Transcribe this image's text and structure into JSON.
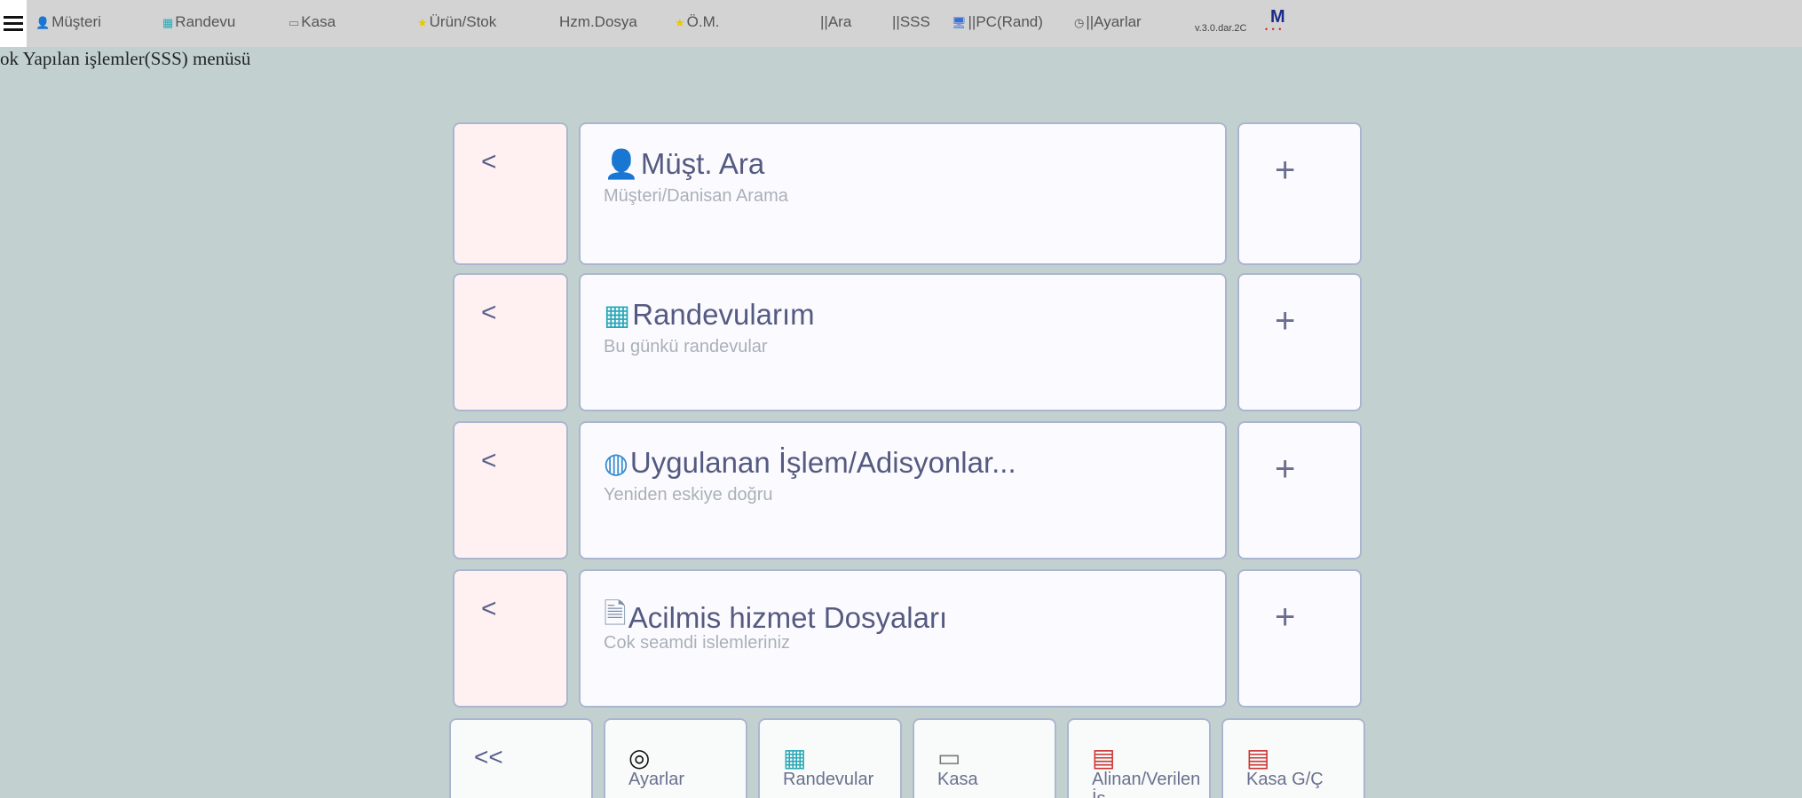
{
  "nav": {
    "items": [
      {
        "label": "Müşteri",
        "icon": "user-icon"
      },
      {
        "label": "Randevu",
        "icon": "calendar-icon"
      },
      {
        "label": "Kasa",
        "icon": "cash-register-icon"
      },
      {
        "label": "Ürün/Stok",
        "icon": "star-icon"
      },
      {
        "label": "Hzm.Dosya",
        "icon": ""
      },
      {
        "label": "Ö.M.",
        "icon": "star-icon"
      },
      {
        "label": "||Ara",
        "icon": ""
      },
      {
        "label": "||SSS",
        "icon": ""
      },
      {
        "label": "||PC(Rand)",
        "icon": "monitor-icon"
      },
      {
        "label": "||Ayarlar",
        "icon": "clock-icon"
      }
    ],
    "version": "v.3.0.dar.2C",
    "logo_letter": "M",
    "logo_dots": "• • •"
  },
  "subtitle": "ok Yapılan işlemler(SSS) menüsü",
  "rows": [
    {
      "back": "<",
      "title": "Müşt. Ara",
      "desc": "Müşteri/Danisan Arama",
      "icon": "user-icon",
      "add": "+"
    },
    {
      "back": "<",
      "title": "Randevularım",
      "desc": "Bu günkü randevular",
      "icon": "calendar-icon",
      "add": "+"
    },
    {
      "back": "<",
      "title": "Uygulanan İşlem/Adisyonlar...",
      "desc": "Yeniden eskiye doğru",
      "icon": "globe-icon",
      "add": "+"
    },
    {
      "back": "<",
      "title": "Acilmis hizmet Dosyaları",
      "desc": "Cok seamdi islemleriniz",
      "icon": "document-icon",
      "add": "+"
    }
  ],
  "bottom": {
    "back": "<<",
    "buttons": [
      {
        "label": "Ayarlar",
        "icon": "settings-icon"
      },
      {
        "label": "Randevular",
        "icon": "calendar-icon"
      },
      {
        "label": "Kasa",
        "icon": "cash-register-icon"
      },
      {
        "label": "Alinan/Verilen İş",
        "icon": "document-icon"
      },
      {
        "label": "Kasa G/Ç",
        "icon": "document-icon"
      }
    ]
  }
}
